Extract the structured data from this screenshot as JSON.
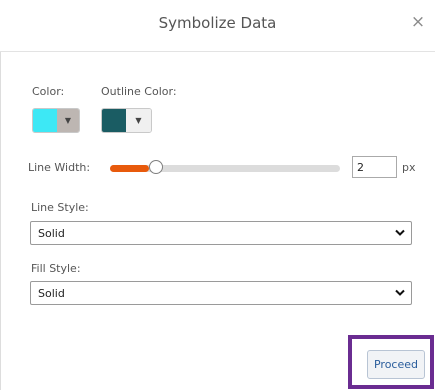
{
  "dialog": {
    "title": "Symbolize Data",
    "close_glyph": "×"
  },
  "color": {
    "label": "Color:",
    "value": "#3de8f5",
    "dropdown_glyph": "▼",
    "arrow_bg": "#bdb6b2"
  },
  "outline_color": {
    "label": "Outline Color:",
    "value": "#1a5c63",
    "dropdown_glyph": "▼",
    "arrow_bg": "#f0f0f0"
  },
  "line_width": {
    "label": "Line Width:",
    "value": "2",
    "unit": "px",
    "slider_fraction": 0.17,
    "fill_color": "#e85a0c"
  },
  "line_style": {
    "label": "Line Style:",
    "value": "Solid"
  },
  "fill_style": {
    "label": "Fill Style:",
    "value": "Solid"
  },
  "actions": {
    "proceed_label": "Proceed",
    "highlight_color": "#6a2c91"
  },
  "icons": {
    "close": "close-icon",
    "dropdown": "caret-down-icon",
    "select": "chevron-down-icon"
  }
}
